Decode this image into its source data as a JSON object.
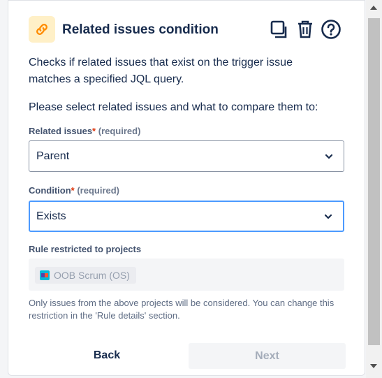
{
  "header": {
    "title": "Related issues condition",
    "icons": {
      "component": "link-icon",
      "copy": "copy-icon",
      "delete": "trash-icon",
      "help": "help-icon"
    },
    "accent": "#ff8b00"
  },
  "description": {
    "line1": "Checks if related issues that exist on the trigger issue",
    "line2": "matches a specified JQL query.",
    "prompt": "Please select related issues and what to compare them to:"
  },
  "related_issues": {
    "label": "Related issues",
    "required_star": "*",
    "required_text": "(required)",
    "value": "Parent"
  },
  "condition": {
    "label": "Condition",
    "required_star": "*",
    "required_text": "(required)",
    "value": "Exists"
  },
  "projects": {
    "label": "Rule restricted to projects",
    "chip": "OOB Scrum (OS)",
    "hint": "Only issues from the above projects will be considered. You can change this restriction in the 'Rule details' section."
  },
  "footer": {
    "back_label": "Back",
    "next_label": "Next"
  }
}
